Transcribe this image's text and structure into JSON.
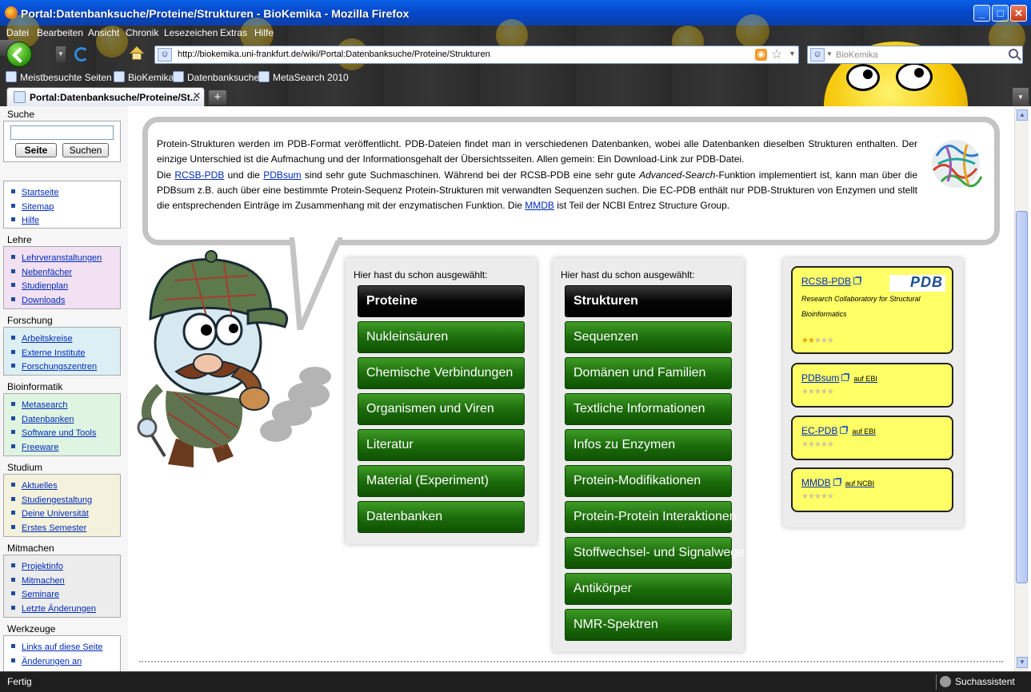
{
  "window": {
    "title": "Portal:Datenbanksuche/Proteine/Strukturen - BioKemika - Mozilla Firefox",
    "minimize": "_",
    "maximize": "□",
    "close": "✕"
  },
  "menu": [
    "Datei",
    "Bearbeiten",
    "Ansicht",
    "Chronik",
    "Lesezeichen",
    "Extras",
    "Hilfe"
  ],
  "nav": {
    "url": "http://biokemika.uni-frankfurt.de/wiki/Portal:Datenbanksuche/Proteine/Strukturen",
    "search_placeholder": "BioKemika"
  },
  "bookmarks": [
    "Meistbesuchte Seiten",
    "BioKemika",
    "Datenbanksuche",
    "MetaSearch 2010"
  ],
  "tab": {
    "active_label": "Portal:Datenbanksuche/Proteine/St...",
    "new_tab": "+"
  },
  "sidebar": {
    "search_title": "Suche",
    "search_value": "",
    "go_button": "Seite",
    "search_button": "Suchen",
    "nav_items": [
      "Startseite",
      "Sitemap",
      "Hilfe"
    ],
    "portals": [
      {
        "title": "Lehre",
        "color": "#f2e1f2",
        "items": [
          "Lehrveranstaltungen",
          "Nebenfächer",
          "Studienplan",
          "Downloads"
        ]
      },
      {
        "title": "Forschung",
        "color": "#dceff5",
        "items": [
          "Arbeitskreise",
          "Externe Institute",
          "Forschungszentren"
        ]
      },
      {
        "title": "Bioinformatik",
        "color": "#dff5e2",
        "items": [
          "Metasearch",
          "Datenbanken",
          "Software und Tools",
          "Freeware"
        ]
      },
      {
        "title": "Studium",
        "color": "#f4f2dc",
        "items": [
          "Aktuelles",
          "Studiengestaltung",
          "Deine Universität",
          "Erstes Semester"
        ]
      },
      {
        "title": "Mitmachen",
        "color": "#ececec",
        "items": [
          "Projektinfo",
          "Mitmachen",
          "Seminare",
          "Letzte Änderungen"
        ]
      },
      {
        "title": "Werkzeuge",
        "color": "#ffffff",
        "items": [
          "Links auf diese Seite",
          "Änderungen an"
        ]
      }
    ]
  },
  "intro": {
    "p1": "Protein-Strukturen werden im PDB-Format veröffentlicht. PDB-Dateien findet man in verschiedenen Datenbanken, wobei alle Datenbanken dieselben Strukturen enthalten. Der einzige Unterschied ist die Aufmachung und der Informationsgehalt der Übersichtsseiten. Allen gemein: Ein Download-Link zur PDB-Datei.",
    "p2_a": "Die ",
    "link_rcsb": "RCSB-PDB",
    "p2_b": " und die ",
    "link_pdbsum": "PDBsum",
    "p2_c": " sind sehr gute Suchmaschinen. Während bei der RCSB-PDB eine sehr gute ",
    "p2_em": "Advanced-Search",
    "p2_d": "-Funktion implementiert ist, kann man über die PDBsum z.B. auch über eine bestimmte Protein-Sequenz Protein-Strukturen mit verwandten Sequenzen suchen. Die EC-PDB enthält nur PDB-Strukturen von Enzymen und stellt die entsprechenden Einträge im Zusammenhang mit der enzymatischen Funktion. Die ",
    "link_mmdb": "MMDB",
    "p2_e": " ist Teil der NCBI Entrez Structure Group."
  },
  "panel1": {
    "header": "Hier hast du schon ausgewählt:",
    "selected": "Proteine",
    "items": [
      "Nukleinsäuren",
      "Chemische Verbindungen",
      "Organismen und Viren",
      "Literatur",
      "Material (Experiment)",
      "Datenbanken"
    ]
  },
  "panel2": {
    "header": "Hier hast du schon ausgewählt:",
    "selected": "Strukturen",
    "items": [
      "Sequenzen",
      "Domänen und Familien",
      "Textliche Informationen",
      "Infos zu Enzymen",
      "Protein-Modifikationen",
      "Protein-Protein Interaktionen",
      "Stoffwechsel- und Signalwege",
      "Antikörper",
      "NMR-Spektren"
    ]
  },
  "databases": [
    {
      "name": "RCSB-PDB",
      "note": "",
      "desc": "Research Collaboratory for Structural Bioinformatics",
      "rating": 2,
      "logo": "PDB"
    },
    {
      "name": "PDBsum",
      "note": "auf EBI",
      "desc": "",
      "rating": 0
    },
    {
      "name": "EC-PDB",
      "note": "auf EBI",
      "desc": "",
      "rating": 0
    },
    {
      "name": "MMDB",
      "note": "auf NCBI",
      "desc": "",
      "rating": 0
    }
  ],
  "status": {
    "text": "Fertig",
    "assistant": "Suchassistent"
  }
}
